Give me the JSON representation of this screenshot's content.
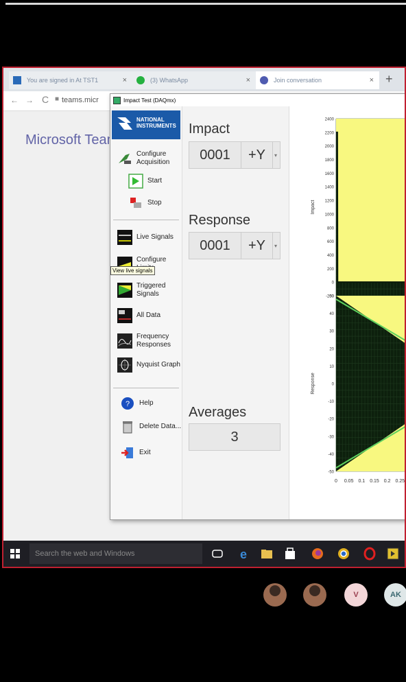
{
  "browser": {
    "tabs": [
      {
        "label": "You are signed in At TST1",
        "active": false
      },
      {
        "label": "(3) WhatsApp",
        "active": false
      },
      {
        "label": "Join conversation",
        "active": true
      }
    ],
    "url": "teams.micr",
    "page_title": "Microsoft Teams"
  },
  "app": {
    "window_title": "Impact Test (DAQmx)",
    "logo": {
      "line1": "NATIONAL",
      "line2": "INSTRUMENTS"
    },
    "sidebar": {
      "top_items": [
        {
          "label": "Configure Acquisition",
          "icon": "configure-icon"
        },
        {
          "label": "Start",
          "icon": "start-icon"
        },
        {
          "label": "Stop",
          "icon": "stop-icon"
        }
      ],
      "view_items": [
        {
          "label": "Live Signals",
          "icon": "live-signals-icon"
        },
        {
          "label": "Configure Limits",
          "icon": "limits-icon"
        },
        {
          "label": "Triggered Signals",
          "icon": "triggered-signals-icon"
        },
        {
          "label": "All Data",
          "icon": "all-data-icon"
        },
        {
          "label": "Frequency Responses",
          "icon": "frequency-icon"
        },
        {
          "label": "Nyquist Graph",
          "icon": "nyquist-icon"
        }
      ],
      "bottom_items": [
        {
          "label": "Help",
          "icon": "help-icon"
        },
        {
          "label": "Delete Data...",
          "icon": "trash-icon"
        },
        {
          "label": "Exit",
          "icon": "exit-icon"
        }
      ],
      "tooltip": "View live signals"
    },
    "impact": {
      "label": "Impact",
      "channel": "0001",
      "direction": "+Y"
    },
    "response": {
      "label": "Response",
      "channel": "0001",
      "direction": "+Y"
    },
    "averages": {
      "label": "Averages",
      "value": "3"
    }
  },
  "chart_data": [
    {
      "type": "area",
      "ylabel": "Impact",
      "ylim": [
        -200,
        2400
      ],
      "yticks": [
        "2400",
        "2200",
        "2000",
        "1800",
        "1600",
        "1400",
        "1200",
        "1000",
        "800",
        "600",
        "400",
        "200",
        "0",
        "-200"
      ],
      "x": [
        0,
        0.005,
        0.006,
        0.3
      ],
      "series": [
        {
          "values": [
            2200,
            2200,
            0,
            0
          ]
        }
      ],
      "fill_color": "#f8f880",
      "plot_bg": "#0d200d",
      "grid": true
    },
    {
      "type": "area",
      "ylabel": "Response",
      "ylim": [
        -50,
        50
      ],
      "yticks": [
        "50",
        "40",
        "30",
        "20",
        "10",
        "0",
        "-10",
        "-20",
        "-30",
        "-40",
        "-50"
      ],
      "xticks": [
        "0",
        "0.05",
        "0.1",
        "0.15",
        "0.2",
        "0.25"
      ],
      "x": [
        0,
        0.3
      ],
      "series": [
        {
          "values_upper": [
            50,
            20
          ],
          "values_lower": [
            -50,
            -20
          ]
        }
      ],
      "fill_color": "#f8f880",
      "plot_bg": "#0d200d",
      "grid": true
    }
  ],
  "taskbar": {
    "search_placeholder": "Search the web and Windows",
    "icons": [
      "task-view-icon",
      "edge-icon",
      "file-explorer-icon",
      "store-icon",
      "firefox-icon",
      "chrome-icon",
      "opera-icon",
      "labview-icon"
    ]
  },
  "participants": [
    {
      "type": "photo"
    },
    {
      "type": "photo"
    },
    {
      "initials": "V",
      "color": "#f3d6d8",
      "text": "#9a4050"
    },
    {
      "initials": "AK",
      "color": "#dfe7e8",
      "text": "#3a6870"
    }
  ]
}
